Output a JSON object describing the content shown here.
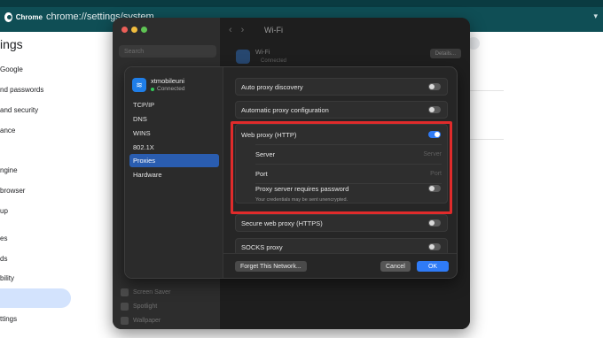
{
  "browser": {
    "tab_label": "Chrome",
    "address": "chrome://settings/system"
  },
  "settings": {
    "title": "ings",
    "nav": [
      "Google",
      "nd passwords",
      "and security",
      "ance",
      "ngine",
      "browser",
      "up",
      "es",
      "ds",
      "bility",
      "ttings"
    ]
  },
  "system_settings": {
    "search_placeholder": "Search",
    "window_title": "Wi-Fi",
    "wifi_label": "Wi-Fi",
    "wifi_status": "Connected",
    "details_button": "Details...",
    "sidebar_items": [
      "Screen Saver",
      "Spotlight",
      "Wallpaper"
    ]
  },
  "dialog": {
    "network_name": "xtmobileuni",
    "network_status": "Connected",
    "side_items": [
      "TCP/IP",
      "DNS",
      "WINS",
      "802.1X",
      "Proxies",
      "Hardware"
    ],
    "selected_side_item": "Proxies",
    "rows": {
      "auto_discovery": "Auto proxy discovery",
      "auto_config": "Automatic proxy configuration",
      "web_proxy": "Web proxy (HTTP)",
      "server_label": "Server",
      "server_placeholder": "Server",
      "port_label": "Port",
      "port_placeholder": "Port",
      "requires_password": "Proxy server requires password",
      "password_note": "Your credentials may be sent unencrypted.",
      "secure_web_proxy": "Secure web proxy (HTTPS)",
      "socks_proxy": "SOCKS proxy"
    },
    "toggles": {
      "auto_discovery": false,
      "auto_config": false,
      "web_proxy": true,
      "requires_password": false,
      "secure_web_proxy": false,
      "socks_proxy": false
    },
    "buttons": {
      "forget": "Forget This Network...",
      "cancel": "Cancel",
      "ok": "OK"
    },
    "highlight_color": "#e02b2b",
    "accent_color": "#2f7bf6"
  }
}
